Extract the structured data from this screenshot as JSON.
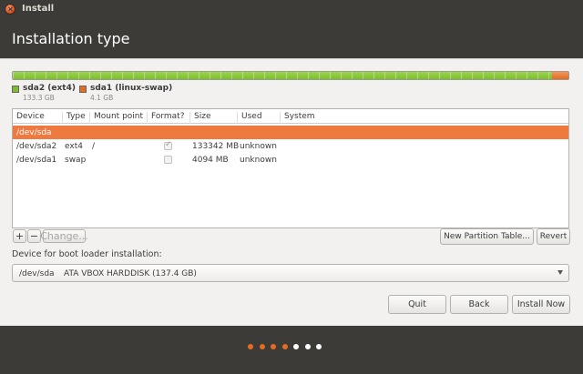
{
  "window": {
    "title": "Install"
  },
  "page": {
    "title": "Installation type"
  },
  "partitions_bar": {
    "segments": [
      {
        "name": "sda2 (ext4)",
        "size": "133.3 GB",
        "color": "#7dbd2b",
        "fraction": 0.97
      },
      {
        "name": "sda1 (linux-swap)",
        "size": "4.1 GB",
        "color": "#e56b20",
        "fraction": 0.03
      }
    ]
  },
  "table": {
    "columns": [
      "Device",
      "Type",
      "Mount point",
      "Format?",
      "Size",
      "Used",
      "System"
    ],
    "rows": [
      {
        "device": "/dev/sda",
        "type": "",
        "mount": "",
        "format": null,
        "size": "",
        "used": "",
        "system": "",
        "selected": true
      },
      {
        "device": "/dev/sda2",
        "type": "ext4",
        "mount": "/",
        "format": true,
        "size": "133342 MB",
        "used": "unknown",
        "system": "",
        "selected": false
      },
      {
        "device": "/dev/sda1",
        "type": "swap",
        "mount": "",
        "format": false,
        "size": "4094 MB",
        "used": "unknown",
        "system": "",
        "selected": false
      }
    ]
  },
  "table_actions": {
    "add": "+",
    "remove": "−",
    "change": "Change...",
    "new_table": "New Partition Table...",
    "revert": "Revert"
  },
  "bootloader": {
    "label": "Device for boot loader installation:",
    "device": "/dev/sda",
    "disk": "ATA VBOX HARDDISK (137.4 GB)"
  },
  "buttons": {
    "quit": "Quit",
    "back": "Back",
    "install": "Install Now"
  },
  "progress": {
    "total": 7,
    "completed": 4,
    "colors": {
      "done": "#e56b20",
      "todo": "#ffffff"
    }
  }
}
